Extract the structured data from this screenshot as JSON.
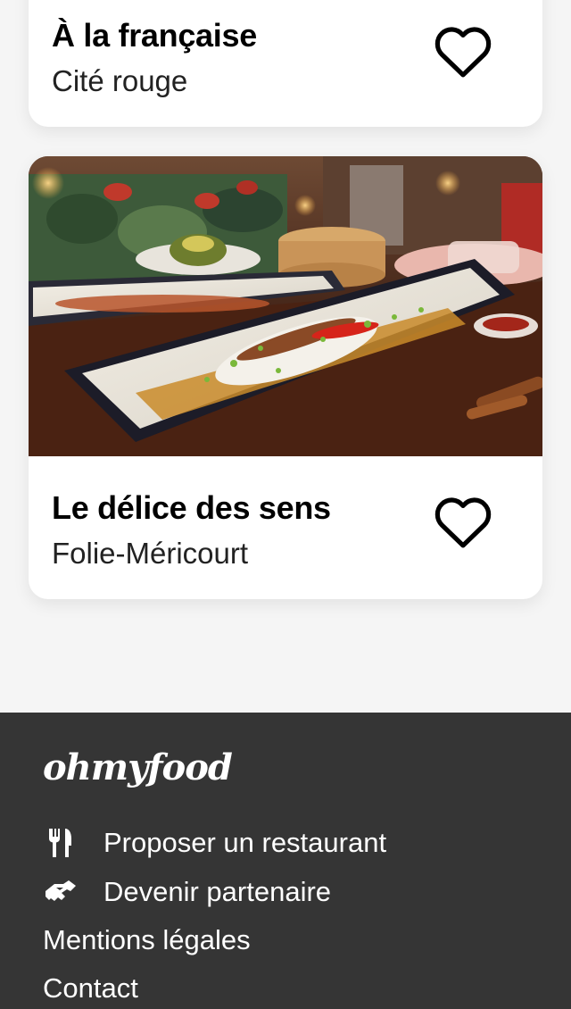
{
  "cards": [
    {
      "title": "À la française",
      "subtitle": "Cité rouge",
      "favorite_icon": "heart-outline-icon"
    },
    {
      "title": "Le délice des sens",
      "subtitle": "Folie-Méricourt",
      "favorite_icon": "heart-outline-icon",
      "image": "restaurant-dish-photo"
    }
  ],
  "footer": {
    "logo": "ohmyfood",
    "links": [
      {
        "label": "Proposer un restaurant",
        "icon": "utensils-icon"
      },
      {
        "label": "Devenir partenaire",
        "icon": "handshake-icon"
      },
      {
        "label": "Mentions légales"
      },
      {
        "label": "Contact"
      }
    ]
  },
  "colors": {
    "page_background": "#f5f5f5",
    "card_background": "#ffffff",
    "footer_background": "#353535",
    "footer_text": "#ffffff"
  }
}
